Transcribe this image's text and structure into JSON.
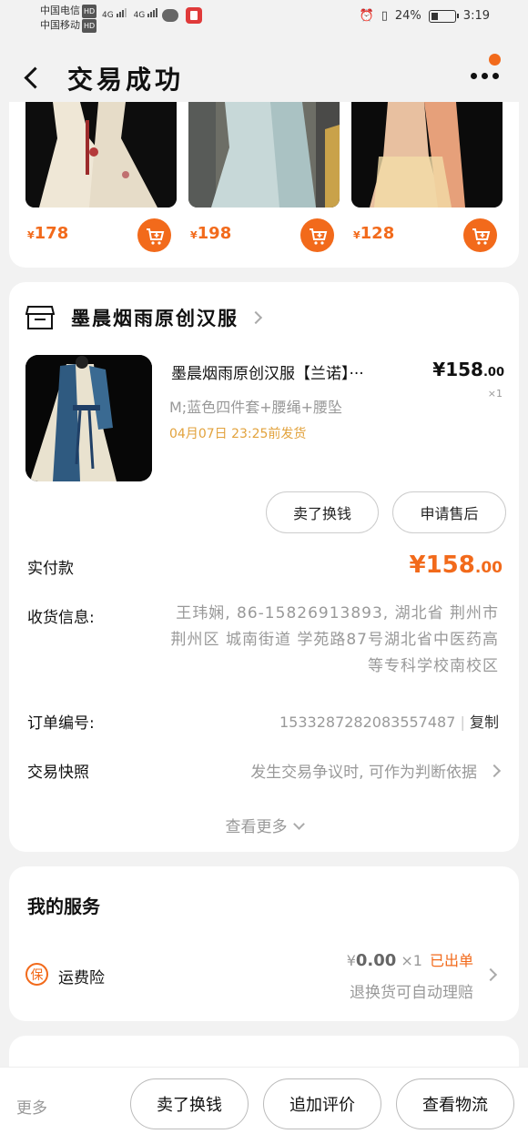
{
  "status_bar": {
    "carrier1": "中国电信",
    "carrier2": "中国移动",
    "hd": "HD",
    "net1": "4G",
    "net2": "4G",
    "battery_percent": "24%",
    "time": "3:19"
  },
  "nav": {
    "title": "交易成功"
  },
  "recommendations": [
    {
      "currency": "¥",
      "price": "178"
    },
    {
      "currency": "¥",
      "price": "198"
    },
    {
      "currency": "¥",
      "price": "128"
    }
  ],
  "order": {
    "shop_name": "墨晨烟雨原创汉服",
    "product_title": "墨晨烟雨原创汉服【兰诺】···",
    "price_symbol": "¥",
    "price_int": "158",
    "price_dec": ".00",
    "qty": "×1",
    "spec": "M;蓝色四件套+腰绳+腰坠",
    "ship_note": "04月07日 23:25前发货",
    "btn_sell": "卖了换钱",
    "btn_aftersale": "申请售后",
    "paid_label": "实付款",
    "paid_symbol": "¥",
    "paid_int": "158",
    "paid_dec": ".00",
    "address_label": "收货信息:",
    "address": "王玮娴, 86-15826913893, 湖北省 荆州市 荆州区 城南街道 学苑路87号湖北省中医药高等专科学校南校区",
    "orderno_label": "订单编号:",
    "orderno": "1533287282083557487",
    "copy": "复制",
    "snapshot_label": "交易快照",
    "snapshot_value": "发生交易争议时, 可作为判断依据",
    "see_more": "查看更多"
  },
  "services": {
    "title": "我的服务",
    "insurance_icon": "保",
    "insurance_label": "运费险",
    "insurance_price_symbol": "¥",
    "insurance_price": "0.00",
    "insurance_qty": "×1",
    "insurance_status": "已出单",
    "insurance_sub": "退换货可自动理赔"
  },
  "next_section": {
    "title": ""
  },
  "bottom_bar": {
    "more": "更多",
    "btn1": "卖了换钱",
    "btn2": "追加评价",
    "btn3": "查看物流"
  },
  "colors": {
    "accent": "#f26a1b",
    "ship_note": "#e2a23c"
  }
}
